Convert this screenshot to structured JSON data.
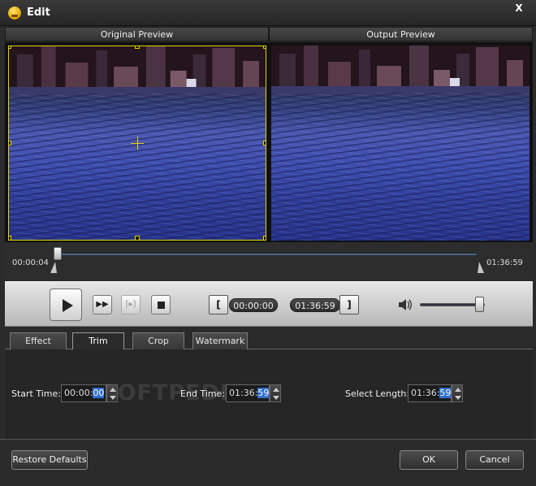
{
  "window": {
    "title": "Edit",
    "close_label": "X"
  },
  "preview": {
    "original_label": "Original Preview",
    "output_label": "Output Preview"
  },
  "timeline": {
    "current_time": "00:00:04",
    "total_time": "01:36:59",
    "position_fraction": 0.0
  },
  "playback": {
    "start_time": "00:00:00",
    "end_time": "01:36:59",
    "start_bracket": "[",
    "end_bracket": "]",
    "fast_forward_label": "▶▶",
    "frame_step_label": "[▸]",
    "volume_fraction": 0.9
  },
  "tabs": [
    {
      "label": "Effect",
      "active": false
    },
    {
      "label": "Trim",
      "active": true
    },
    {
      "label": "Crop",
      "active": false
    },
    {
      "label": "Watermark",
      "active": false
    }
  ],
  "trim": {
    "start_label": "Start Time:",
    "start_value_prefix": "00:00:",
    "start_value_selected": "00",
    "end_label": "End Time:",
    "end_value_prefix": "01:36:",
    "end_value_selected": "59",
    "length_label": "Select Length:",
    "length_value_prefix": "01:36:",
    "length_value_selected": "59",
    "watermark_text": "SOFTPEDIA"
  },
  "footer": {
    "restore_label": "Restore Defaults",
    "ok_label": "OK",
    "cancel_label": "Cancel"
  }
}
